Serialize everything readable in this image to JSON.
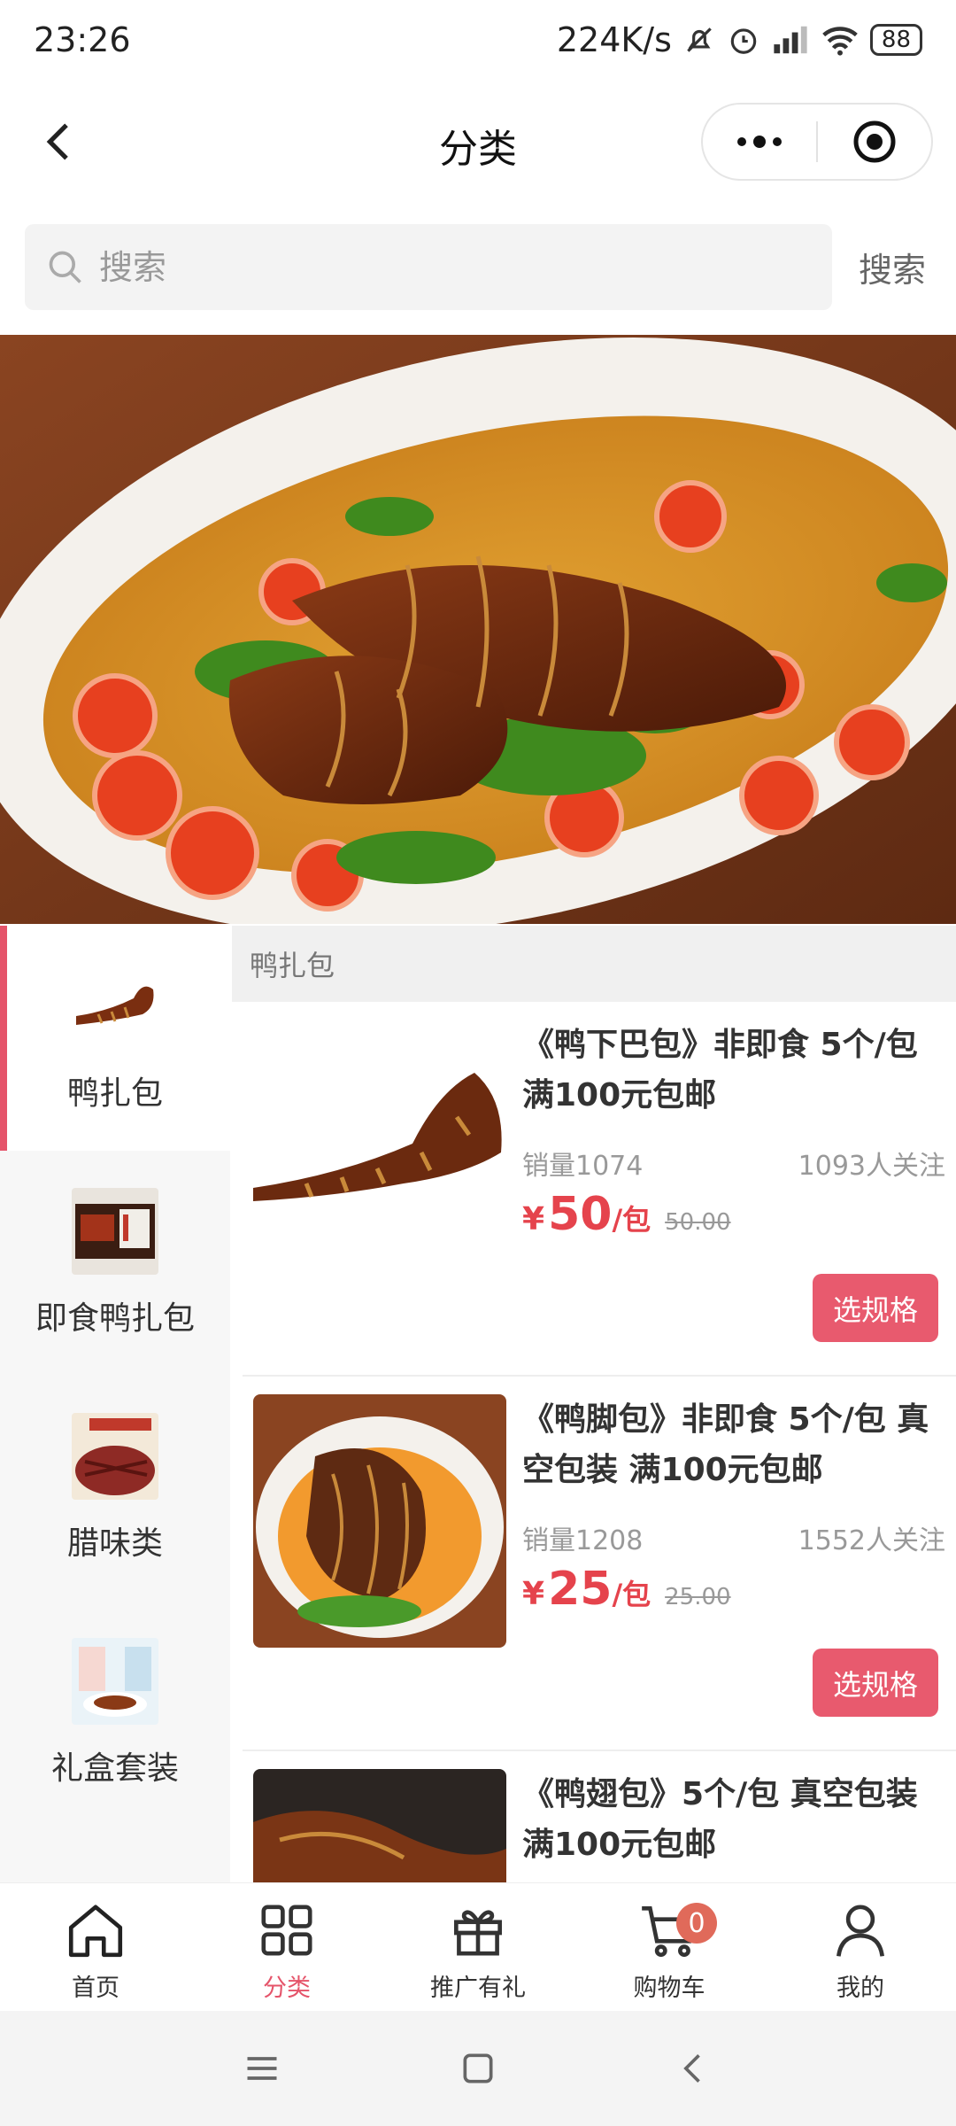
{
  "status_bar": {
    "time": "23:26",
    "net_speed": "224K/s",
    "battery": "88"
  },
  "nav": {
    "title": "分类"
  },
  "search": {
    "placeholder": "搜索",
    "button_label": "搜索"
  },
  "categories": [
    {
      "label": "鸭扎包",
      "active": true
    },
    {
      "label": "即食鸭扎包",
      "active": false
    },
    {
      "label": "腊味类",
      "active": false
    },
    {
      "label": "礼盒套装",
      "active": false
    }
  ],
  "section_title": "鸭扎包",
  "products": [
    {
      "title": "《鸭下巴包》非即食 5个/包 满100元包邮",
      "sales": "销量1074",
      "followers": "1093人关注",
      "currency": "¥",
      "price": "50",
      "unit": "/包",
      "original_price": "50.00",
      "button_label": "选规格"
    },
    {
      "title": "《鸭脚包》非即食 5个/包 真空包装 满100元包邮",
      "sales": "销量1208",
      "followers": "1552人关注",
      "currency": "¥",
      "price": "25",
      "unit": "/包",
      "original_price": "25.00",
      "button_label": "选规格"
    },
    {
      "title": "《鸭翅包》5个/包 真空包装 满100元包邮"
    }
  ],
  "tabbar": {
    "home": "首页",
    "category": "分类",
    "promo": "推广有礼",
    "cart": "购物车",
    "cart_count": "0",
    "mine": "我的"
  },
  "colors": {
    "accent": "#e5546a",
    "price": "#e5434c",
    "button": "#e85a6e"
  }
}
